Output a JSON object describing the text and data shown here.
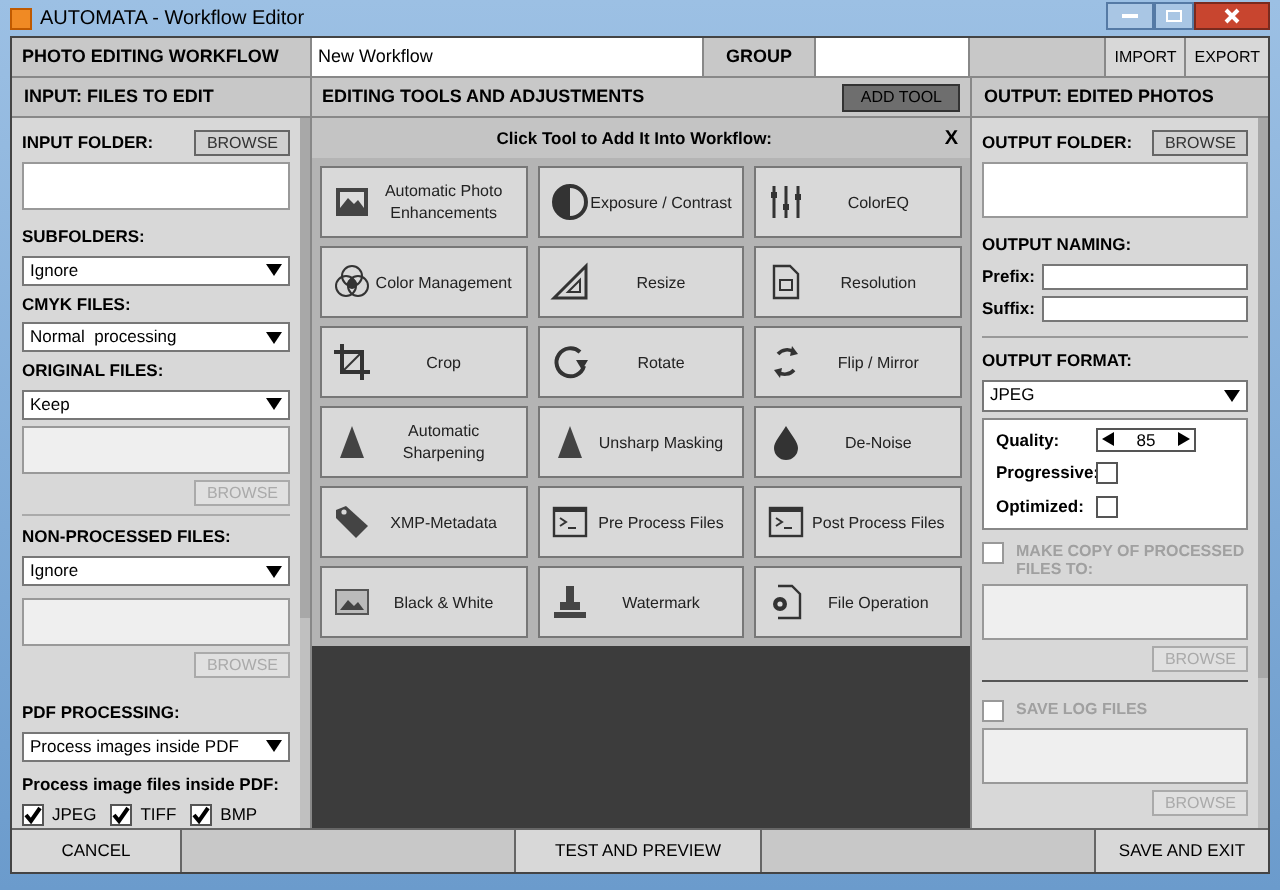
{
  "window": {
    "title": "AUTOMATA - Workflow Editor"
  },
  "header": {
    "title": "PHOTO EDITING WORKFLOW",
    "workflow_name": "New Workflow",
    "group_label": "GROUP",
    "buttons": [
      "IMPORT",
      "EXPORT"
    ]
  },
  "input_panel": {
    "title": "INPUT: FILES TO EDIT",
    "input_folder": {
      "label": "INPUT FOLDER:",
      "browse": "BROWSE"
    },
    "subfolders": {
      "label": "SUBFOLDERS:",
      "value": "Ignore"
    },
    "cmyk_files": {
      "label": "CMYK FILES:",
      "value": "Normal  processing"
    },
    "original_files": {
      "label": "ORIGINAL FILES:",
      "value": "Keep",
      "browse": "BROWSE",
      "disabled": true
    },
    "non_processed_files": {
      "label": "NON-PROCESSED FILES:",
      "value": "Ignore",
      "browse": "BROWSE",
      "disabled": true
    },
    "pdf_processing": {
      "label": "PDF PROCESSING:",
      "value": "Process images inside PDF",
      "formats_label": "Process image files inside PDF:",
      "formats": [
        {
          "label": "JPEG",
          "checked": true
        },
        {
          "label": "TIFF",
          "checked": true
        },
        {
          "label": "BMP",
          "checked": true
        }
      ]
    }
  },
  "tools_panel": {
    "title": "EDITING TOOLS AND ADJUSTMENTS",
    "add_button": "ADD TOOL",
    "picker_title": "Click Tool to Add It Into Workflow:",
    "close": "X",
    "tools": [
      "Automatic Photo Enhancements",
      "Exposure / Contrast",
      "ColorEQ",
      "Color Management",
      "Resize",
      "Resolution",
      "Crop",
      "Rotate",
      "Flip / Mirror",
      "Automatic Sharpening",
      "Unsharp Masking",
      "De-Noise",
      "XMP-Metadata",
      "Pre Process Files",
      "Post Process Files",
      "Black & White",
      "Watermark",
      "File Operation"
    ]
  },
  "output_panel": {
    "title": "OUTPUT: EDITED PHOTOS",
    "output_folder": {
      "label": "OUTPUT FOLDER:",
      "browse": "BROWSE"
    },
    "naming": {
      "label": "OUTPUT NAMING:",
      "prefix_label": "Prefix:",
      "suffix_label": "Suffix:"
    },
    "format": {
      "label": "OUTPUT FORMAT:",
      "value": "JPEG",
      "quality_label": "Quality:",
      "quality": "85",
      "progressive_label": "Progressive:",
      "progressive": false,
      "optimized_label": "Optimized:",
      "optimized": false
    },
    "copy": {
      "label": "MAKE COPY OF PROCESSED FILES TO:",
      "checked": false,
      "disabled": true,
      "browse": "BROWSE"
    },
    "log": {
      "label": "SAVE LOG FILES",
      "checked": false,
      "disabled": true,
      "browse": "BROWSE"
    }
  },
  "footer": {
    "buttons": [
      "CANCEL",
      "TEST AND PREVIEW",
      "SAVE AND EXIT"
    ]
  }
}
